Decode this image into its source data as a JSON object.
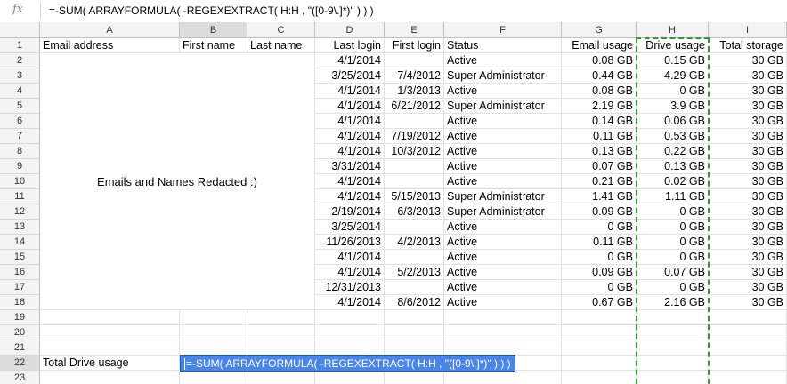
{
  "formula_bar": {
    "fx_label": "fx",
    "formula": "=-SUM( ARRAYFORMULA( -REGEXEXTRACT( H:H , \"([0-9\\.]*)\" ) ) )"
  },
  "columns": [
    {
      "letter": "A"
    },
    {
      "letter": "B"
    },
    {
      "letter": "C"
    },
    {
      "letter": "D"
    },
    {
      "letter": "E"
    },
    {
      "letter": "F"
    },
    {
      "letter": "G"
    },
    {
      "letter": "H"
    },
    {
      "letter": "I"
    }
  ],
  "header_row": {
    "A": "Email address",
    "B": "First name",
    "C": "Last name",
    "D": "Last login",
    "E": "First login",
    "F": "Status",
    "G": "Email usage",
    "H": "Drive usage",
    "I": "Total storage"
  },
  "redacted_note": "Emails and Names Redacted :)",
  "rows": [
    {
      "num": "2",
      "D": "4/1/2014",
      "E": "",
      "F": "Active",
      "G": "0.08 GB",
      "H": "0.15 GB",
      "I": "30 GB"
    },
    {
      "num": "3",
      "D": "3/25/2014",
      "E": "7/4/2012",
      "F": "Super Administrator",
      "G": "0.44 GB",
      "H": "4.29 GB",
      "I": "30 GB"
    },
    {
      "num": "4",
      "D": "4/1/2014",
      "E": "1/3/2013",
      "F": "Active",
      "G": "0.08 GB",
      "H": "0 GB",
      "I": "30 GB"
    },
    {
      "num": "5",
      "D": "4/1/2014",
      "E": "6/21/2012",
      "F": "Super Administrator",
      "G": "2.19 GB",
      "H": "3.9 GB",
      "I": "30 GB"
    },
    {
      "num": "6",
      "D": "4/1/2014",
      "E": "",
      "F": "Active",
      "G": "0.14 GB",
      "H": "0.06 GB",
      "I": "30 GB"
    },
    {
      "num": "7",
      "D": "4/1/2014",
      "E": "7/19/2012",
      "F": "Active",
      "G": "0.11 GB",
      "H": "0.53 GB",
      "I": "30 GB"
    },
    {
      "num": "8",
      "D": "4/1/2014",
      "E": "10/3/2012",
      "F": "Active",
      "G": "0.13 GB",
      "H": "0.22 GB",
      "I": "30 GB"
    },
    {
      "num": "9",
      "D": "3/31/2014",
      "E": "",
      "F": "Active",
      "G": "0.07 GB",
      "H": "0.13 GB",
      "I": "30 GB"
    },
    {
      "num": "10",
      "D": "4/1/2014",
      "E": "",
      "F": "Active",
      "G": "0.21 GB",
      "H": "0.02 GB",
      "I": "30 GB"
    },
    {
      "num": "11",
      "D": "4/1/2014",
      "E": "5/15/2013",
      "F": "Super Administrator",
      "G": "1.41 GB",
      "H": "1.11 GB",
      "I": "30 GB"
    },
    {
      "num": "12",
      "D": "2/19/2014",
      "E": "6/3/2013",
      "F": "Super Administrator",
      "G": "0.09 GB",
      "H": "0 GB",
      "I": "30 GB"
    },
    {
      "num": "13",
      "D": "3/25/2014",
      "E": "",
      "F": "Active",
      "G": "0 GB",
      "H": "0 GB",
      "I": "30 GB"
    },
    {
      "num": "14",
      "D": "11/26/2013",
      "E": "4/2/2013",
      "F": "Active",
      "G": "0.11 GB",
      "H": "0 GB",
      "I": "30 GB"
    },
    {
      "num": "15",
      "D": "4/1/2014",
      "E": "",
      "F": "Active",
      "G": "0 GB",
      "H": "0 GB",
      "I": "30 GB"
    },
    {
      "num": "16",
      "D": "4/1/2014",
      "E": "5/2/2013",
      "F": "Active",
      "G": "0.09 GB",
      "H": "0.07 GB",
      "I": "30 GB"
    },
    {
      "num": "17",
      "D": "12/31/2013",
      "E": "",
      "F": "Active",
      "G": "0 GB",
      "H": "0 GB",
      "I": "30 GB"
    },
    {
      "num": "18",
      "D": "4/1/2014",
      "E": "8/6/2012",
      "F": "Active",
      "G": "0.67 GB",
      "H": "2.16 GB",
      "I": "30 GB"
    }
  ],
  "blank_rows": [
    "19",
    "20",
    "21"
  ],
  "total_row": {
    "num": "22",
    "label": "Total Drive usage",
    "editor_text": "=-SUM( ARRAYFORMULA( -REGEXEXTRACT( H:H , \"([0-9\\.]*)\" ) ) )"
  },
  "last_row": {
    "num": "23"
  },
  "selected": {
    "column": "B",
    "row": "22"
  },
  "colors": {
    "editor_bg": "#4a86e8",
    "copy_border": "#2e9c2e",
    "header_bg": "#f3f3f3"
  }
}
